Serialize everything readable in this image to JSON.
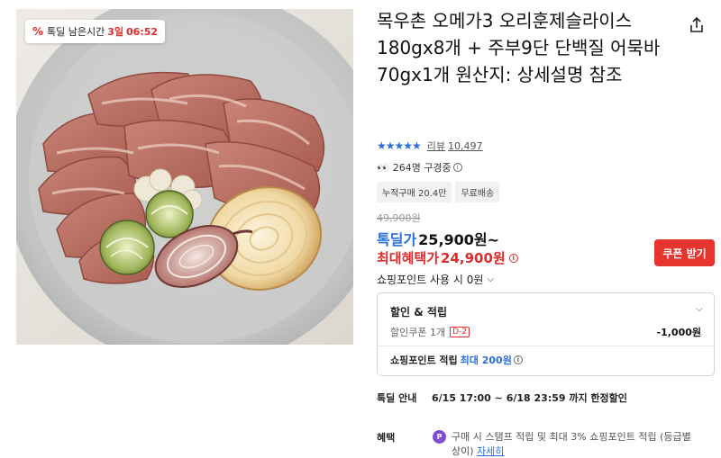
{
  "deal_timer": {
    "label": "톡딜 남은시간",
    "days": "3일",
    "time": "06:52"
  },
  "product": {
    "title": "목우촌 오메가3 오리훈제슬라이스 180gx8개 + 주부9단 단백질 어묵바70gx1개 원산지: 상세설명 참조"
  },
  "rating": {
    "stars": "★★★★★",
    "review_label": "리뷰",
    "review_count": "10,497"
  },
  "watching": {
    "text": "264명 구경중",
    "icon": "eyes-icon"
  },
  "tags": [
    "누적구매 20.4만",
    "무료배송"
  ],
  "price": {
    "original": "49,900원",
    "deal_label": "톡딜가",
    "deal_value": "25,900원~",
    "max_label": "최대혜택가",
    "max_value": "24,900원"
  },
  "coupon_button": "쿠폰 받기",
  "points_toggle": "쇼핑포인트 사용 시 0원",
  "discount": {
    "header": "할인 & 적립",
    "coupon_label": "할인쿠폰 1개",
    "coupon_dday": "D-2",
    "coupon_amount": "-1,000원",
    "point_label": "쇼핑포인트 적립",
    "point_value": "최대 200원"
  },
  "deal_info": {
    "label": "톡딜 안내",
    "value": "6/15 17:00 ~ 6/18 23:59 까지 한정할인"
  },
  "benefit": {
    "label": "혜택",
    "text": "구매 시 스탬프 적립 및 최대 3% 쇼핑포인트 적립 (등급별 상이)",
    "link": "자세히"
  },
  "colors": {
    "accent_blue": "#2b6fd8",
    "accent_red": "#e22a2a",
    "coupon_button": "#e5352e",
    "point_badge": "#7c4dcc"
  }
}
